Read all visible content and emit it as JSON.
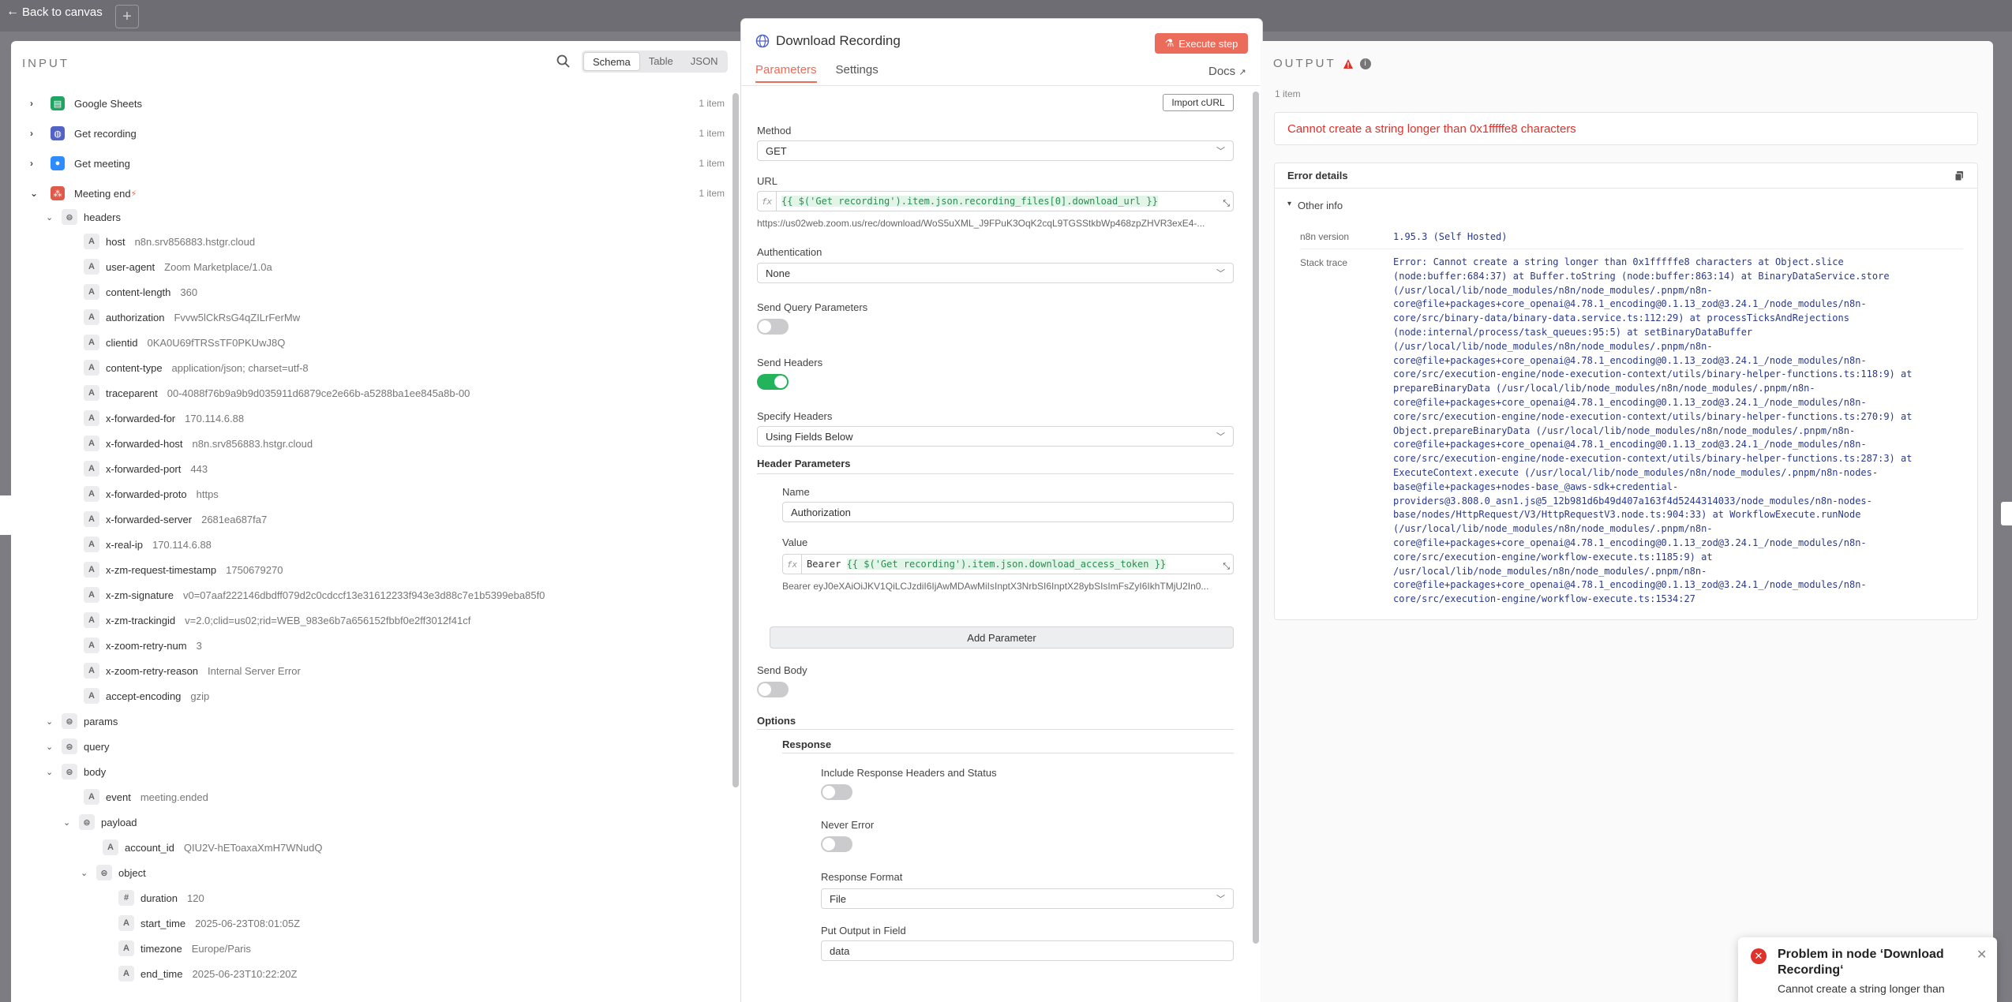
{
  "canvas": {
    "back_label": "Back to canvas",
    "plus_label": "+"
  },
  "input": {
    "title": "INPUT",
    "views": [
      "Schema",
      "Table",
      "JSON"
    ],
    "nodes": [
      {
        "name": "Google Sheets",
        "count": "1 item",
        "color": "#1fa463",
        "glyph": "▤"
      },
      {
        "name": "Get recording",
        "count": "1 item",
        "color": "#5263c7",
        "glyph": "◍"
      },
      {
        "name": "Get meeting",
        "count": "1 item",
        "color": "#2d8cff",
        "glyph": "●"
      },
      {
        "name": "Meeting end",
        "count": "1 item",
        "color": "#e05a4a",
        "glyph": "⁂"
      }
    ],
    "headers_label": "headers",
    "headers": [
      {
        "key": "host",
        "val": "n8n.srv856883.hstgr.cloud"
      },
      {
        "key": "user-agent",
        "val": "Zoom Marketplace/1.0a"
      },
      {
        "key": "content-length",
        "val": "360"
      },
      {
        "key": "authorization",
        "val": "Fvvw5lCkRsG4qZILrFerMw"
      },
      {
        "key": "clientid",
        "val": "0KA0U69fTRSsTF0PKUwJ8Q"
      },
      {
        "key": "content-type",
        "val": "application/json; charset=utf-8"
      },
      {
        "key": "traceparent",
        "val": "00-4088f76b9a9b9d035911d6879ce2e66b-a5288ba1ee845a8b-00"
      },
      {
        "key": "x-forwarded-for",
        "val": "170.114.6.88"
      },
      {
        "key": "x-forwarded-host",
        "val": "n8n.srv856883.hstgr.cloud"
      },
      {
        "key": "x-forwarded-port",
        "val": "443"
      },
      {
        "key": "x-forwarded-proto",
        "val": "https"
      },
      {
        "key": "x-forwarded-server",
        "val": "2681ea687fa7"
      },
      {
        "key": "x-real-ip",
        "val": "170.114.6.88"
      },
      {
        "key": "x-zm-request-timestamp",
        "val": "1750679270"
      },
      {
        "key": "x-zm-signature",
        "val": "v0=07aaf222146dbdff079d2c0cdccf13e31612233f943e3d88c7e1b5399eba85f0"
      },
      {
        "key": "x-zm-trackingid",
        "val": "v=2.0;clid=us02;rid=WEB_983e6b7a656152fbbf0e2ff3012f41cf"
      },
      {
        "key": "x-zoom-retry-num",
        "val": "3"
      },
      {
        "key": "x-zoom-retry-reason",
        "val": "Internal Server Error"
      },
      {
        "key": "accept-encoding",
        "val": "gzip"
      }
    ],
    "params_label": "params",
    "query_label": "query",
    "body_label": "body",
    "event_key": "event",
    "event_val": "meeting.ended",
    "payload_label": "payload",
    "account_key": "account_id",
    "account_val": "QIU2V-hEToaxaXmH7WNudQ",
    "object_label": "object",
    "obj_fields": [
      {
        "type": "#",
        "key": "duration",
        "val": "120"
      },
      {
        "type": "A",
        "key": "start_time",
        "val": "2025-06-23T08:01:05Z"
      },
      {
        "type": "A",
        "key": "timezone",
        "val": "Europe/Paris"
      },
      {
        "type": "A",
        "key": "end_time",
        "val": "2025-06-23T10:22:20Z"
      }
    ]
  },
  "node": {
    "title": "Download Recording",
    "execute_label": "Execute step",
    "tabs": [
      "Parameters",
      "Settings"
    ],
    "docs_label": "Docs",
    "import_label": "Import cURL",
    "method_label": "Method",
    "method_val": "GET",
    "url_label": "URL",
    "url_expr_a": "{{ $('Get recording').item.json.recording_files[0].download_url }}",
    "url_hint": "https://us02web.zoom.us/rec/download/WoS5uXML_J9FPuK3OqK2cqL9TGSStkbWp468zpZHVR3exE4-...",
    "auth_label": "Authentication",
    "auth_val": "None",
    "send_query_label": "Send Query Parameters",
    "send_headers_label": "Send Headers",
    "specify_headers_label": "Specify Headers",
    "specify_headers_val": "Using Fields Below",
    "header_params_label": "Header Parameters",
    "name_label": "Name",
    "name_val": "Authorization",
    "value_label": "Value",
    "value_expr_plain": "Bearer ",
    "value_expr_code": "{{ $('Get recording').item.json.download_access_token }}",
    "value_hint": "Bearer eyJ0eXAiOiJKV1QiLCJzdiI6IjAwMDAwMiIsInptX3NrbSI6InptX28ybSIsImFsZyI6IkhTMjU2In0...",
    "add_param_label": "Add Parameter",
    "send_body_label": "Send Body",
    "options_label": "Options",
    "response_label": "Response",
    "include_resp_label": "Include Response Headers and Status",
    "never_error_label": "Never Error",
    "resp_format_label": "Response Format",
    "resp_format_val": "File",
    "put_output_label": "Put Output in Field",
    "put_output_val": "data"
  },
  "output": {
    "title": "OUTPUT",
    "items": "1 item",
    "error_msg": "Cannot create a string longer than 0x1fffffe8 characters",
    "details_label": "Error details",
    "other_info_label": "Other info",
    "version_label": "n8n version",
    "version_val": "1.95.3 (Self Hosted)",
    "stack_label": "Stack trace",
    "stack_val": "Error: Cannot create a string longer than 0x1fffffe8 characters at Object.slice\n(node:buffer:684:37) at Buffer.toString (node:buffer:863:14) at BinaryDataService.store\n(/usr/local/lib/node_modules/n8n/node_modules/.pnpm/n8n-\ncore@file+packages+core_openai@4.78.1_encoding@0.1.13_zod@3.24.1_/node_modules/n8n-\ncore/src/binary-data/binary-data.service.ts:112:29) at processTicksAndRejections\n(node:internal/process/task_queues:95:5) at setBinaryDataBuffer\n(/usr/local/lib/node_modules/n8n/node_modules/.pnpm/n8n-\ncore@file+packages+core_openai@4.78.1_encoding@0.1.13_zod@3.24.1_/node_modules/n8n-\ncore/src/execution-engine/node-execution-context/utils/binary-helper-functions.ts:118:9) at\nprepareBinaryData (/usr/local/lib/node_modules/n8n/node_modules/.pnpm/n8n-\ncore@file+packages+core_openai@4.78.1_encoding@0.1.13_zod@3.24.1_/node_modules/n8n-\ncore/src/execution-engine/node-execution-context/utils/binary-helper-functions.ts:270:9) at\nObject.prepareBinaryData (/usr/local/lib/node_modules/n8n/node_modules/.pnpm/n8n-\ncore@file+packages+core_openai@4.78.1_encoding@0.1.13_zod@3.24.1_/node_modules/n8n-\ncore/src/execution-engine/node-execution-context/utils/binary-helper-functions.ts:287:3) at\nExecuteContext.execute (/usr/local/lib/node_modules/n8n/node_modules/.pnpm/n8n-nodes-\nbase@file+packages+nodes-base_@aws-sdk+credential-\nproviders@3.808.0_asn1.js@5_12b981d6b49d407a163f4d5244314033/node_modules/n8n-nodes-\nbase/nodes/HttpRequest/V3/HttpRequestV3.node.ts:904:33) at WorkflowExecute.runNode\n(/usr/local/lib/node_modules/n8n/node_modules/.pnpm/n8n-\ncore@file+packages+core_openai@4.78.1_encoding@0.1.13_zod@3.24.1_/node_modules/n8n-\ncore/src/execution-engine/workflow-execute.ts:1185:9) at\n/usr/local/lib/node_modules/n8n/node_modules/.pnpm/n8n-\ncore@file+packages+core_openai@4.78.1_encoding@0.1.13_zod@3.24.1_/node_modules/n8n-\ncore/src/execution-engine/workflow-execute.ts:1534:27"
  },
  "toast": {
    "title": "Problem in node ‘Download Recording‘",
    "message": "Cannot create a string longer than"
  }
}
